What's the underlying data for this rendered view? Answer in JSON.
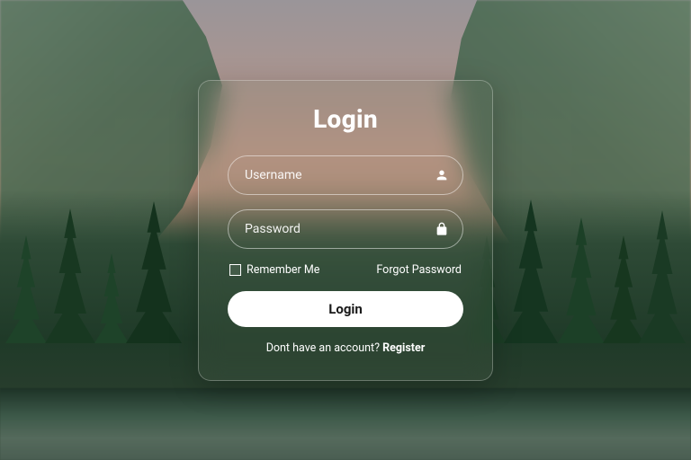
{
  "login": {
    "title": "Login",
    "username_placeholder": "Username",
    "password_placeholder": "Password",
    "remember_label": "Remember Me",
    "forgot_label": "Forgot Password",
    "submit_label": "Login",
    "register_prompt": "Dont have an account? ",
    "register_action": "Register"
  },
  "icons": {
    "user": "user-icon",
    "lock": "lock-icon"
  }
}
